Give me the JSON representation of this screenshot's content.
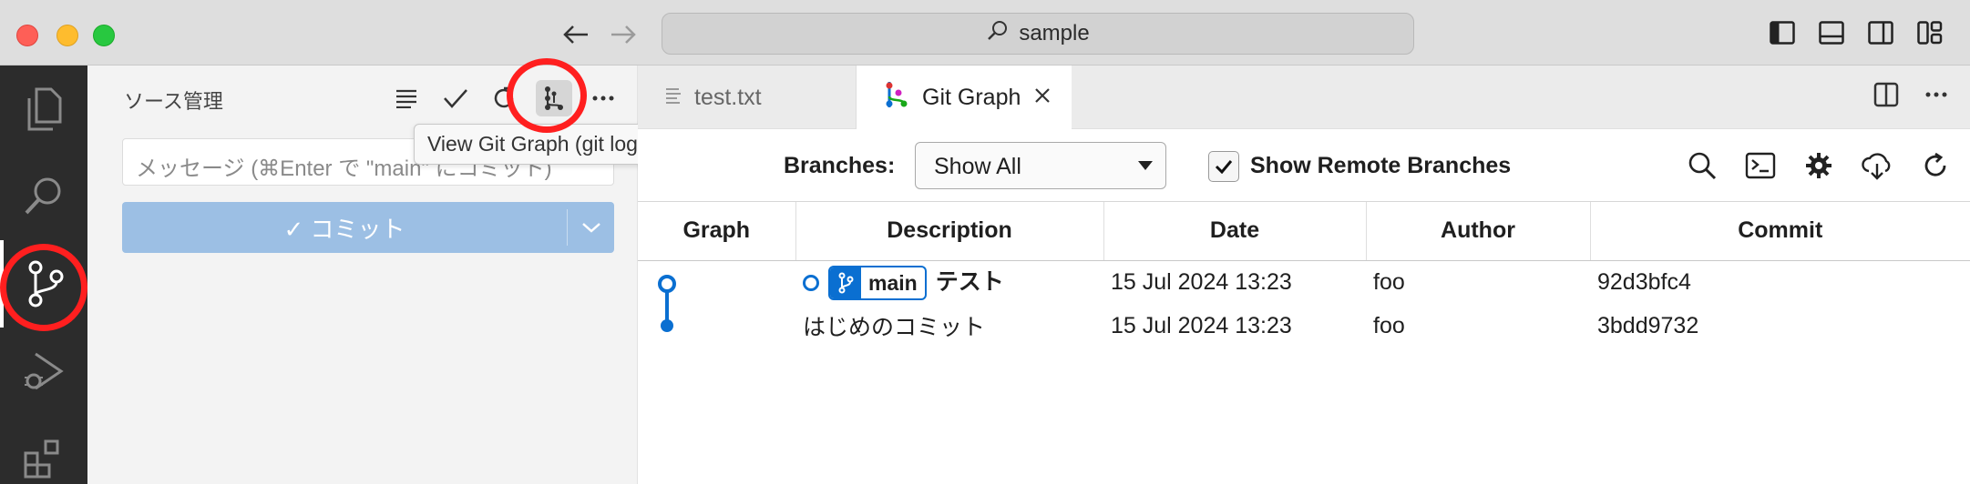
{
  "window": {
    "title": "sample"
  },
  "sidebar": {
    "title": "ソース管理",
    "message_placeholder": "メッセージ (⌘Enter で \"main\" にコミット)",
    "commit_label": "✓ コミット",
    "tooltip": "View Git Graph (git log)"
  },
  "tabs": [
    {
      "label": "test.txt"
    },
    {
      "label": "Git Graph"
    }
  ],
  "toolbar": {
    "branches_label": "Branches:",
    "branches_value": "Show All",
    "remote_label": "Show Remote Branches",
    "remote_checked": true
  },
  "table": {
    "headers": [
      "Graph",
      "Description",
      "Date",
      "Author",
      "Commit"
    ],
    "rows": [
      {
        "branch": "main",
        "description": "テスト",
        "date": "15 Jul 2024 13:23",
        "author": "foo",
        "commit": "92d3bfc4"
      },
      {
        "description": "はじめのコミット",
        "date": "15 Jul 2024 13:23",
        "author": "foo",
        "commit": "3bdd9732"
      }
    ]
  },
  "colors": {
    "accent": "#0a6fd1",
    "highlight_ring": "#ff1f1f",
    "commit_button": "#9cbfe4"
  }
}
